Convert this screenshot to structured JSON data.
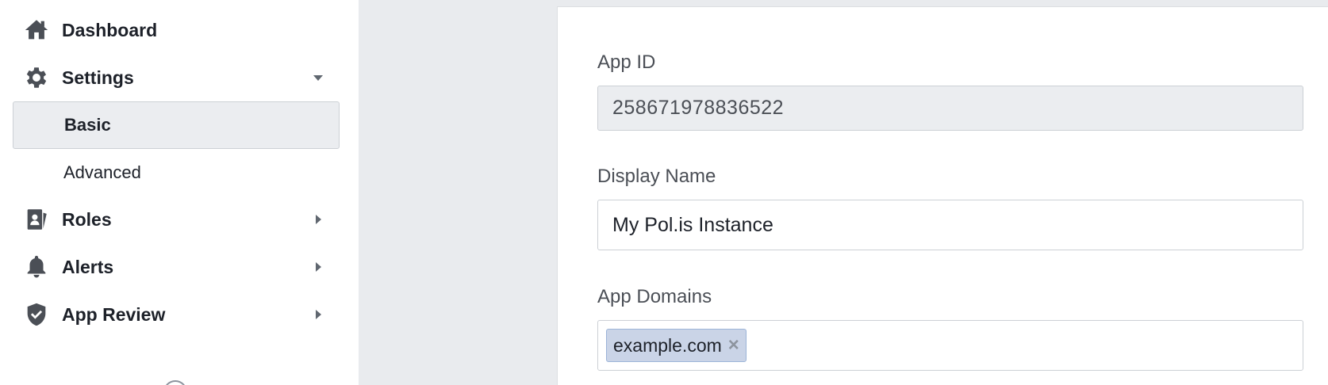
{
  "sidebar": {
    "items": [
      {
        "label": "Dashboard",
        "icon": "home-icon"
      },
      {
        "label": "Settings",
        "icon": "gear-icon",
        "expanded": true,
        "children": [
          {
            "label": "Basic",
            "active": true
          },
          {
            "label": "Advanced",
            "active": false
          }
        ]
      },
      {
        "label": "Roles",
        "icon": "roles-icon"
      },
      {
        "label": "Alerts",
        "icon": "bell-icon"
      },
      {
        "label": "App Review",
        "icon": "shield-check-icon"
      }
    ]
  },
  "form": {
    "app_id": {
      "label": "App ID",
      "value": "258671978836522"
    },
    "display_name": {
      "label": "Display Name",
      "value": "My Pol.is Instance"
    },
    "app_domains": {
      "label": "App Domains",
      "tags": [
        "example.com"
      ],
      "remove_glyph": "×"
    }
  },
  "colors": {
    "background": "#e9ebee",
    "icon": "#4b4f56",
    "tag_bg": "#cad4e7",
    "active_item_bg": "#ebedf0"
  }
}
